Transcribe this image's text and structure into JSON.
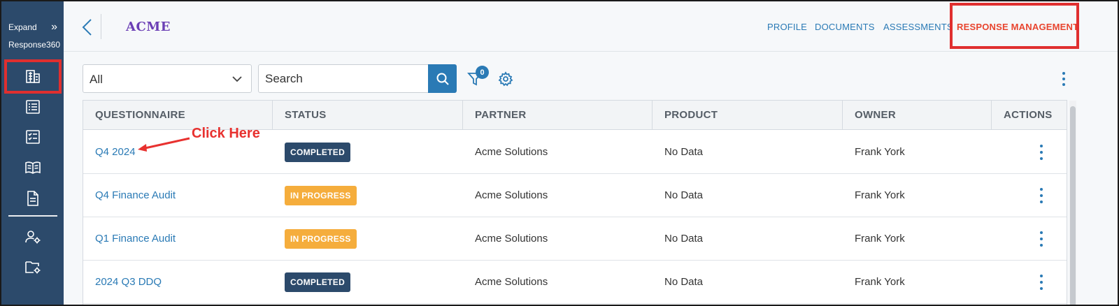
{
  "sidebar": {
    "expand_label": "Expand",
    "app_name": "Response360",
    "icons": [
      "building-icon",
      "checklist-icon",
      "check-list-icon",
      "book-icon",
      "document-icon",
      "user-settings-icon",
      "folder-settings-icon"
    ]
  },
  "header": {
    "logo": "ACME",
    "nav": [
      {
        "label": "PROFILE"
      },
      {
        "label": "DOCUMENTS"
      },
      {
        "label": "ASSESSMENTS"
      },
      {
        "label": "RESPONSE MANAGEMENT",
        "active": true
      }
    ]
  },
  "toolbar": {
    "dropdown_value": "All",
    "search_placeholder": "Search",
    "filter_count": "0"
  },
  "table": {
    "columns": [
      "QUESTIONNAIRE",
      "STATUS",
      "PARTNER",
      "PRODUCT",
      "OWNER",
      "ACTIONS"
    ],
    "rows": [
      {
        "questionnaire": "Q4 2024",
        "status": "COMPLETED",
        "partner": "Acme Solutions",
        "product": "No Data",
        "owner": "Frank York"
      },
      {
        "questionnaire": "Q4 Finance Audit",
        "status": "IN PROGRESS",
        "partner": "Acme Solutions",
        "product": "No Data",
        "owner": "Frank York"
      },
      {
        "questionnaire": "Q1 Finance Audit",
        "status": "IN PROGRESS",
        "partner": "Acme Solutions",
        "product": "No Data",
        "owner": "Frank York"
      },
      {
        "questionnaire": "2024 Q3 DDQ",
        "status": "COMPLETED",
        "partner": "Acme Solutions",
        "product": "No Data",
        "owner": "Frank York"
      }
    ]
  },
  "annotation": {
    "text": "Click Here"
  },
  "colors": {
    "sidebar_bg": "#2c4a6b",
    "accent": "#2a7ab5",
    "active_nav": "#e8452f",
    "completed": "#2c4a6b",
    "in_progress": "#f5ad3c",
    "highlight_box": "#e02f2f"
  }
}
